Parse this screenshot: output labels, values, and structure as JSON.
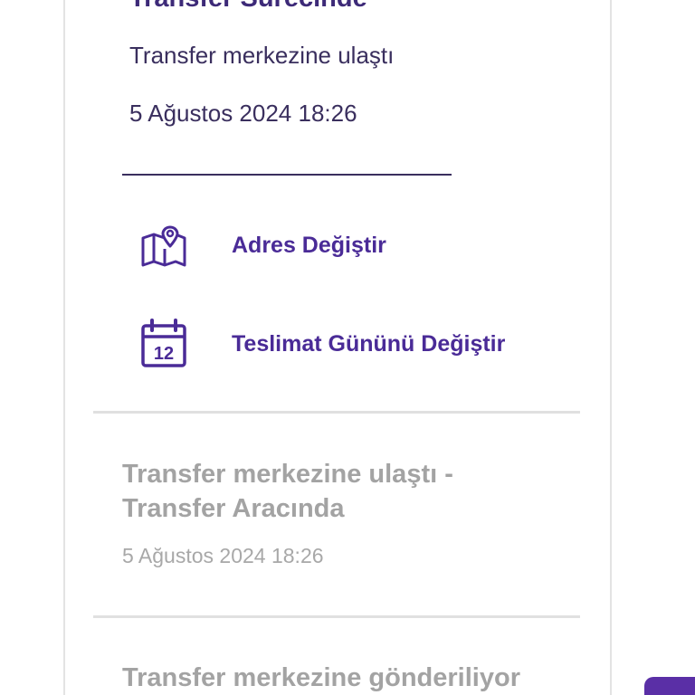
{
  "current_status": {
    "title": "Transfer Sürecinde",
    "description": "Transfer merkezine ulaştı",
    "date": "5 Ağustos 2024 18:26"
  },
  "actions": [
    {
      "label": "Adres Değiştir",
      "icon": "map-pin-icon"
    },
    {
      "label": "Teslimat Gününü Değiştir",
      "icon": "calendar-icon",
      "icon_text": "12"
    }
  ],
  "history": [
    {
      "title_line1": "Transfer merkezine ulaştı -",
      "title_line2": "Transfer Aracında",
      "date": "5 Ağustos 2024 18:26"
    },
    {
      "title_line1": "Transfer merkezine gönderiliyor"
    }
  ],
  "colors": {
    "accent": "#4a2b97",
    "title": "#3d2a78",
    "muted": "#a3a3a3",
    "divider": "#e0e0e0"
  }
}
